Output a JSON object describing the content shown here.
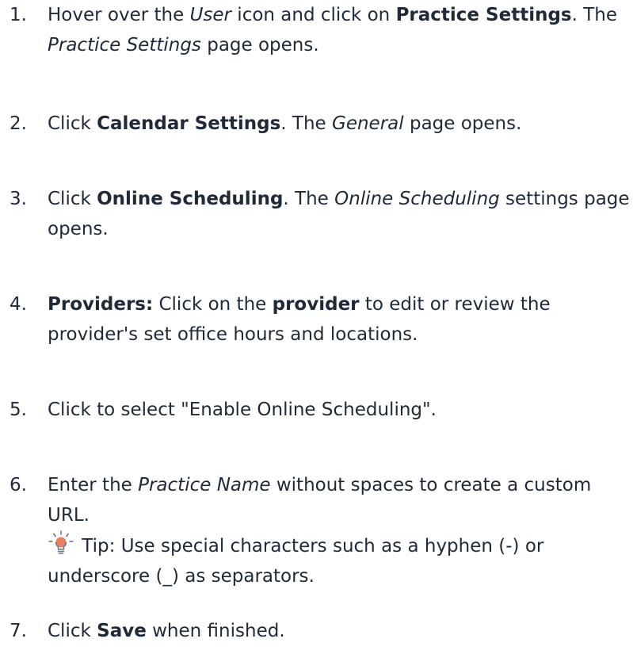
{
  "steps": [
    {
      "number": "1.",
      "parts": [
        {
          "text": "Hover over the ",
          "style": "normal"
        },
        {
          "text": "User",
          "style": "italic"
        },
        {
          "text": " icon and click on ",
          "style": "normal"
        },
        {
          "text": "Practice Settings",
          "style": "bold"
        },
        {
          "text": ". The ",
          "style": "normal"
        },
        {
          "text": "Practice Settings",
          "style": "italic"
        },
        {
          "text": " page opens.",
          "style": "normal"
        }
      ]
    },
    {
      "number": "2.",
      "parts": [
        {
          "text": "Click ",
          "style": "normal"
        },
        {
          "text": "Calendar Settings",
          "style": "bold"
        },
        {
          "text": ". The ",
          "style": "normal"
        },
        {
          "text": "General",
          "style": "italic"
        },
        {
          "text": " page opens.",
          "style": "normal"
        }
      ]
    },
    {
      "number": "3.",
      "parts": [
        {
          "text": "Click ",
          "style": "normal"
        },
        {
          "text": "Online Scheduling",
          "style": "bold"
        },
        {
          "text": ". The ",
          "style": "normal"
        },
        {
          "text": "Online Scheduling",
          "style": "italic"
        },
        {
          "text": " settings page opens.",
          "style": "normal"
        }
      ]
    },
    {
      "number": "4.",
      "parts": [
        {
          "text": "Providers:",
          "style": "bold"
        },
        {
          "text": " Click on the ",
          "style": "normal"
        },
        {
          "text": "provider",
          "style": "bold"
        },
        {
          "text": " to edit or review the provider's set office hours and locations.",
          "style": "normal"
        }
      ]
    },
    {
      "number": "5.",
      "parts": [
        {
          "text": "Click to select \"Enable Online Scheduling\".",
          "style": "normal"
        }
      ]
    },
    {
      "number": "6.",
      "parts": [
        {
          "text": "Enter the ",
          "style": "normal"
        },
        {
          "text": "Practice Name",
          "style": "italic"
        },
        {
          "text": " without spaces to create a custom URL.",
          "style": "normal"
        }
      ],
      "tip": {
        "icon": "lightbulb-icon",
        "text": " Tip: Use special characters such as a hyphen (-) or underscore (_) as separators."
      }
    },
    {
      "number": "7.",
      "parts": [
        {
          "text": "Click ",
          "style": "normal"
        },
        {
          "text": "Save",
          "style": "bold"
        },
        {
          "text": " when finished.",
          "style": "normal"
        }
      ]
    }
  ]
}
